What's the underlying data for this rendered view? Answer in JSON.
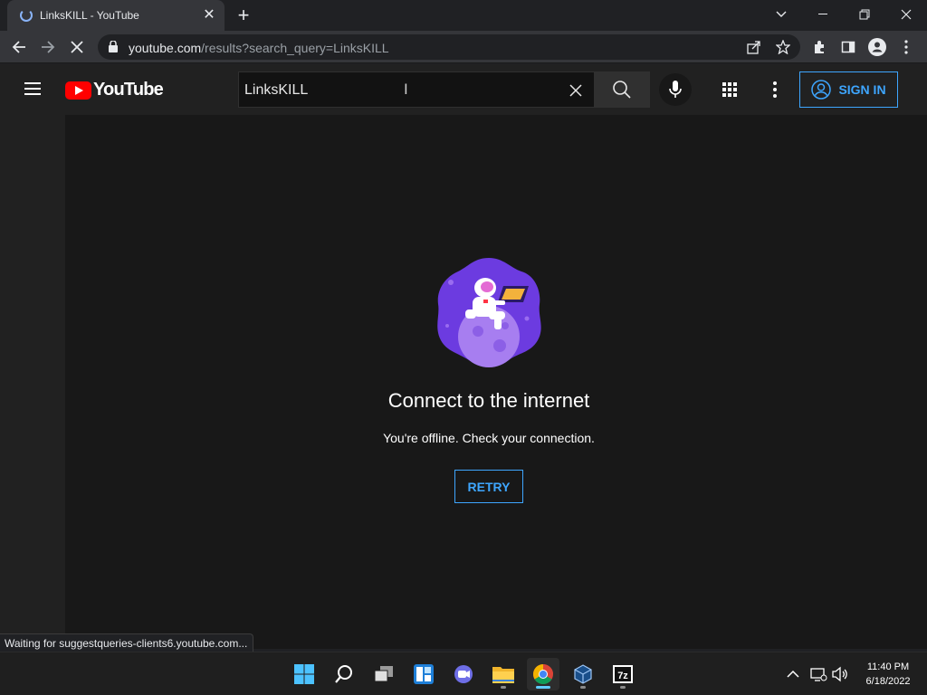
{
  "browser": {
    "tab_title": "LinksKILL - YouTube",
    "url_host": "youtube.com",
    "url_path": "/results?search_query=LinksKILL",
    "status_text": "Waiting for suggestqueries-clients6.youtube.com..."
  },
  "youtube": {
    "logo_text": "YouTube",
    "search_value": "LinksKILL",
    "signin_label": "SIGN IN"
  },
  "offline": {
    "title": "Connect to the internet",
    "message": "You're offline. Check your connection.",
    "retry_label": "RETRY"
  },
  "clock": {
    "time": "11:40 PM",
    "date": "6/18/2022"
  },
  "taskbar": {
    "apps": [
      "start",
      "search",
      "task-view",
      "widgets",
      "teams-chat",
      "file-explorer",
      "chrome",
      "virtualbox",
      "7zip"
    ],
    "active": "chrome"
  },
  "colors": {
    "accent_blue": "#3ea6ff",
    "youtube_red": "#ff0000",
    "illustration_purple": "#6c3be0"
  }
}
